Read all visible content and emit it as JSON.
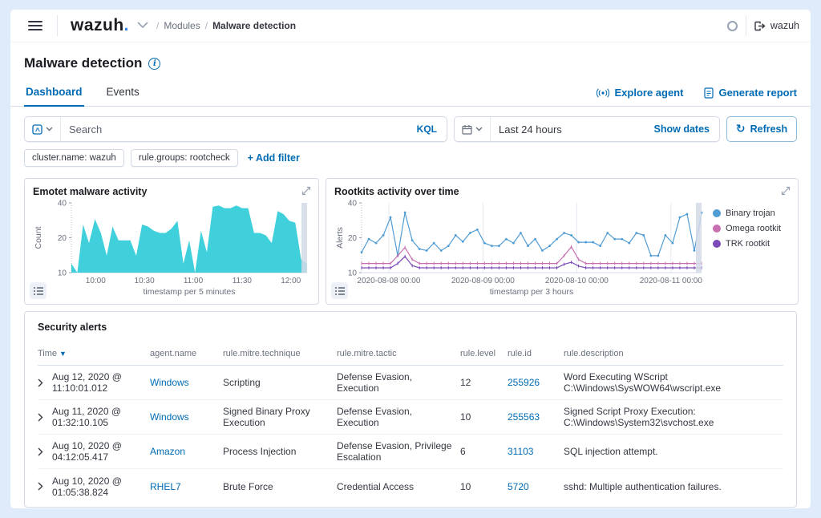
{
  "colors": {
    "accent": "#006BB4",
    "area_teal": "#3FD0DC",
    "line_blue": "#509CD5",
    "line_pink": "#C76FB1",
    "line_purple": "#7B4CB8",
    "border": "#D3DAE6",
    "muted_text": "#69707D",
    "partial_bucket": "#D3DAE6"
  },
  "topbar": {
    "logo": "wazuh",
    "logo_dot": ".",
    "breadcrumb_section": "Modules",
    "breadcrumb_page": "Malware detection",
    "user": "wazuh"
  },
  "page": {
    "title": "Malware detection"
  },
  "tabs": [
    {
      "label": "Dashboard"
    },
    {
      "label": "Events"
    }
  ],
  "actions": {
    "explore_agent": "Explore agent",
    "generate_report": "Generate report"
  },
  "search": {
    "placeholder": "Search",
    "language": "KQL"
  },
  "datepicker": {
    "value": "Last 24 hours",
    "show_dates": "Show dates",
    "refresh_label": "Refresh"
  },
  "filters": {
    "pills": [
      {
        "label": "cluster.name: wazuh"
      },
      {
        "label": "rule.groups: rootcheck"
      }
    ],
    "add_filter": "+ Add filter"
  },
  "icons": {
    "refresh": "↻",
    "sort_down": "▼"
  },
  "chart_data": [
    {
      "type": "area",
      "title": "Emotet malware activity",
      "xlabel": "timestamp per 5 minutes",
      "ylabel": "Count",
      "yscale": "log",
      "ylim": [
        10,
        40
      ],
      "yticks": [
        10,
        20,
        40
      ],
      "grid": false,
      "color": "#3FD0DC",
      "xticks": [
        {
          "label": "10:00",
          "frac": 0.103
        },
        {
          "label": "10:30",
          "frac": 0.31
        },
        {
          "label": "11:00",
          "frac": 0.517
        },
        {
          "label": "11:30",
          "frac": 0.724
        },
        {
          "label": "12:00",
          "frac": 0.931
        }
      ],
      "values": [
        12,
        10,
        26,
        18,
        29,
        22,
        14,
        25,
        19,
        19,
        19,
        14,
        26,
        25,
        23,
        22,
        22,
        24,
        28,
        12,
        19,
        10,
        23,
        15,
        37,
        38,
        36,
        36,
        38,
        36,
        36,
        22,
        22,
        21,
        18,
        34,
        32,
        28,
        27,
        13,
        12
      ],
      "partial_bucket_marker": true
    },
    {
      "type": "line",
      "title": "Rootkits activity over time",
      "xlabel": "timestamp per 3 hours",
      "ylabel": "Alerts",
      "yscale": "log",
      "ylim": [
        10,
        40
      ],
      "yticks": [
        10,
        20,
        40
      ],
      "grid": true,
      "legend_position": "right",
      "xticks": [
        {
          "label": "2020-08-08 00:00",
          "frac": 0.08
        },
        {
          "label": "2020-08-09 00:00",
          "frac": 0.357
        },
        {
          "label": "2020-08-10 00:00",
          "frac": 0.633
        },
        {
          "label": "2020-08-11 00:00",
          "frac": 0.91
        }
      ],
      "series": [
        {
          "name": "Binary trojan",
          "color": "#509CD5",
          "marker": "circle",
          "values": [
            15,
            19.5,
            18,
            21,
            30,
            14,
            33,
            19,
            16,
            15.5,
            18,
            15.5,
            17,
            21,
            18.5,
            22,
            23.5,
            18,
            17,
            17,
            19.5,
            18,
            22,
            17,
            19.5,
            15.5,
            17,
            19.5,
            22,
            21,
            18.3,
            18.3,
            18.3,
            17,
            22,
            19.5,
            19.5,
            18,
            22,
            21,
            14,
            14,
            21,
            18,
            30,
            32,
            15.5,
            33
          ]
        },
        {
          "name": "Omega rootkit",
          "color": "#C76FB1",
          "marker": "tick",
          "values": [
            12,
            12,
            12,
            12,
            12,
            14,
            16.5,
            13,
            12,
            12,
            12,
            12,
            12,
            12,
            12,
            12,
            12,
            12,
            12,
            12,
            12,
            12,
            12,
            12,
            12,
            12,
            12,
            12,
            14,
            16.7,
            13,
            12,
            12,
            12,
            12,
            12,
            12,
            12,
            12,
            12,
            12,
            12,
            12,
            12,
            12,
            12,
            12,
            12
          ]
        },
        {
          "name": "TRK rootkit",
          "color": "#7B4CB8",
          "marker": "tick",
          "values": [
            11,
            11,
            11,
            11,
            11,
            12,
            13.8,
            11.5,
            11,
            11,
            11,
            11,
            11,
            11,
            11,
            11,
            11,
            11,
            11,
            11,
            11,
            11,
            11,
            11,
            11,
            11,
            11,
            11,
            11.8,
            12.3,
            11.4,
            11,
            11,
            11,
            11,
            11,
            11,
            11,
            11,
            11,
            11,
            11,
            11,
            11,
            11,
            11,
            11,
            11
          ]
        }
      ],
      "partial_bucket_marker": true
    }
  ],
  "alerts_panel": {
    "title": "Security alerts"
  },
  "table": {
    "headers": [
      "Time",
      "agent.name",
      "rule.mitre.technique",
      "rule.mitre.tactic",
      "rule.level",
      "rule.id",
      "rule.description"
    ],
    "rows": [
      {
        "time": "Aug 12, 2020 @ 11:10:01.012",
        "agent": "Windows",
        "technique": "Scripting",
        "tactic": "Defense Evasion, Execution",
        "level": "12",
        "id": "255926",
        "description": "Word Executing WScript C:\\Windows\\SysWOW64\\wscript.exe"
      },
      {
        "time": "Aug 11, 2020 @ 01:32:10.105",
        "agent": "Windows",
        "technique": "Signed Binary Proxy Execution",
        "tactic": "Defense Evasion, Execution",
        "level": "10",
        "id": "255563",
        "description": "Signed Script Proxy Execution: C:\\Windows\\System32\\svchost.exe"
      },
      {
        "time": "Aug 10, 2020 @ 04:12:05.417",
        "agent": "Amazon",
        "technique": "Process Injection",
        "tactic": "Defense Evasion, Privilege Escalation",
        "level": "6",
        "id": "31103",
        "description": "SQL injection attempt."
      },
      {
        "time": "Aug 10, 2020 @ 01:05:38.824",
        "agent": "RHEL7",
        "technique": "Brute Force",
        "tactic": "Credential Access",
        "level": "10",
        "id": "5720",
        "description": "sshd: Multiple authentication failures."
      }
    ]
  }
}
